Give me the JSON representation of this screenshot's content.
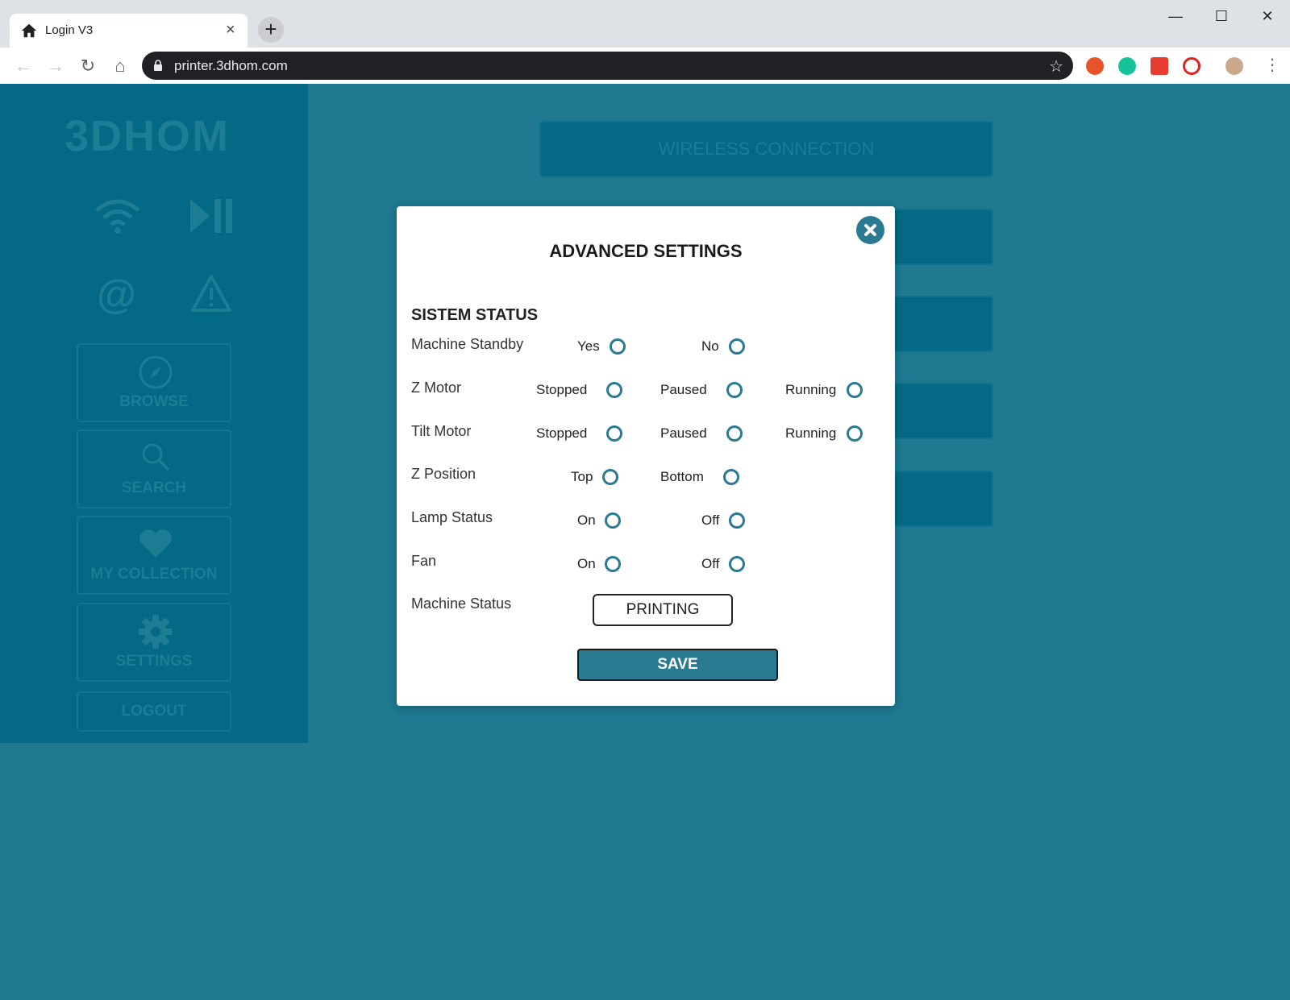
{
  "browser": {
    "tab_title": "Login V3",
    "tab_close": "×",
    "new_tab": "+",
    "url": "printer.3dhom.com",
    "window_buttons": {
      "minimize": "—",
      "maximize": "☐",
      "close": "✕"
    },
    "nav": {
      "back": "←",
      "forward": "→",
      "reload": "↻",
      "home": "⌂"
    },
    "star": "☆",
    "menu": "⋮"
  },
  "sidebar": {
    "logo": "3DHOM",
    "items": [
      {
        "label": "BROWSE",
        "icon": "compass-icon"
      },
      {
        "label": "SEARCH",
        "icon": "search-icon"
      },
      {
        "label": "MY COLLECTION",
        "icon": "heart-icon"
      },
      {
        "label": "SETTINGS",
        "icon": "gear-icon"
      }
    ],
    "logout_label": "LOGOUT"
  },
  "main": {
    "buttons": [
      "WIRELESS CONNECTION",
      "",
      "",
      "",
      ""
    ]
  },
  "modal": {
    "title": "ADVANCED SETTINGS",
    "close_glyph": "✖",
    "section_title": "SISTEM STATUS",
    "rows": [
      {
        "label": "Machine Standby",
        "options": [
          "Yes",
          "No"
        ]
      },
      {
        "label": "Z Motor",
        "options": [
          "Stopped",
          "Paused",
          "Running"
        ]
      },
      {
        "label": "Tilt Motor",
        "options": [
          "Stopped",
          "Paused",
          "Running"
        ]
      },
      {
        "label": "Z Position",
        "options": [
          "Top",
          "Bottom"
        ]
      },
      {
        "label": "Lamp Status",
        "options": [
          "On",
          "Off"
        ]
      },
      {
        "label": "Fan",
        "options": [
          "On",
          "Off"
        ]
      }
    ],
    "machine_status_label": "Machine Status",
    "machine_status_value": "PRINTING",
    "save_label": "SAVE"
  },
  "colors": {
    "page_bg": "#1e7991",
    "sidebar_bg": "#046984",
    "accent": "#2a7b92"
  }
}
